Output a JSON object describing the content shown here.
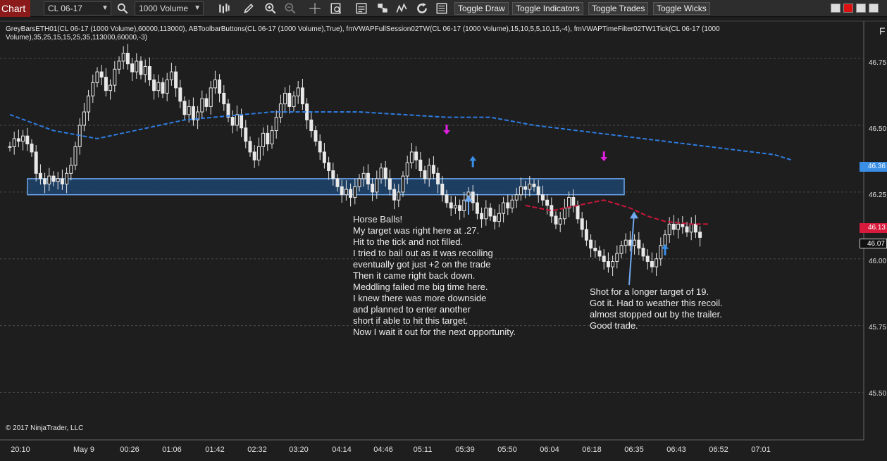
{
  "toolbar": {
    "chart_tab": "Chart",
    "instrument": "CL 06-17",
    "bar_type": "1000 Volume",
    "buttons": [
      "Toggle Draw",
      "Toggle Indicators",
      "Toggle Trades",
      "Toggle Wicks"
    ],
    "side_glyph": "F"
  },
  "indicator_text": "GreyBarsETH01(CL 06-17 (1000 Volume),60000,113000), ABToolbarButtons(CL 06-17 (1000 Volume),True), fmVWAPFullSession02TW(CL 06-17 (1000 Volume),15,10,5,5,10,15,-4), fmVWAPTimeFilter02TW1Tick(CL 06-17 (1000 Volume),35,25,15,15,25,35,113000,60000,-3)",
  "annotations": {
    "left_note": "Horse Balls!\nMy target was right here at .27.\nHit to the tick and not filled.\nI tried to bail out as it was recoiling\neventually got just +2 on the trade\nThen it came right back down.\nMeddling failed me big time here.\nI knew there was more downside\nand planned to enter another\nshort if able to hit this target.\nNow I wait it out for the next opportunity.",
    "right_note": "Shot for a longer target of 19.\nGot it. Had to weather this recoil.\nalmost stopped out by the trailer.\nGood trade."
  },
  "copyright": "© 2017 NinjaTrader, LLC",
  "price_tags": [
    {
      "label": "46.36",
      "color": "#3a8ee6"
    },
    {
      "label": "46.13",
      "color": "#d81b3c"
    },
    {
      "label": "46.07",
      "color": "#111111"
    }
  ],
  "colors": {
    "background": "#1e1e1e",
    "grid": "#4a4a4a",
    "candle": "#e8e8e8",
    "vwap_full": "#2e7be0",
    "vwap_filter": "#c8173a",
    "zone_fill": "#1f4a78",
    "zone_border": "#6fa8ee",
    "arrow_entry": "#e020e0",
    "arrow_exit": "#3a8ee6"
  },
  "chart_data": {
    "type": "candlestick",
    "title": "",
    "instrument": "CL 06-17 (1000 Volume)",
    "ylim": [
      45.33,
      46.89
    ],
    "y_ticks": [
      "46.75",
      "46.50",
      "46.25",
      "46.00",
      "45.75",
      "45.50"
    ],
    "x_ticks": [
      "20:10",
      "May 9",
      "00:26",
      "01:06",
      "01:42",
      "02:32",
      "03:20",
      "04:14",
      "04:46",
      "05:11",
      "05:39",
      "05:50",
      "06:04",
      "06:18",
      "06:35",
      "06:43",
      "06:52",
      "07:01"
    ],
    "close_series": [
      46.42,
      46.45,
      46.44,
      46.46,
      46.43,
      46.4,
      46.32,
      46.3,
      46.28,
      46.31,
      46.29,
      46.3,
      46.28,
      46.32,
      46.35,
      46.42,
      46.5,
      46.55,
      46.61,
      46.66,
      46.7,
      46.68,
      46.63,
      46.65,
      46.71,
      46.74,
      46.77,
      46.73,
      46.7,
      46.74,
      46.69,
      46.72,
      46.67,
      46.63,
      46.66,
      46.62,
      46.67,
      46.7,
      46.64,
      46.59,
      46.54,
      46.57,
      46.52,
      46.55,
      46.6,
      46.57,
      46.64,
      46.67,
      46.62,
      46.58,
      46.53,
      46.5,
      46.54,
      46.49,
      46.44,
      46.4,
      46.37,
      46.42,
      46.47,
      46.43,
      46.48,
      46.53,
      46.58,
      46.62,
      46.57,
      46.61,
      46.64,
      46.58,
      46.52,
      46.48,
      46.44,
      46.4,
      46.36,
      46.33,
      46.3,
      46.27,
      46.24,
      46.26,
      46.23,
      46.27,
      46.3,
      46.32,
      46.28,
      46.25,
      46.3,
      46.34,
      46.3,
      46.26,
      46.22,
      46.25,
      46.31,
      46.36,
      46.4,
      46.37,
      46.33,
      46.3,
      46.35,
      46.32,
      46.28,
      46.24,
      46.21,
      46.19,
      46.2,
      46.18,
      46.22,
      46.25,
      46.21,
      46.17,
      46.15,
      46.19,
      46.16,
      46.14,
      46.17,
      46.21,
      46.19,
      46.22,
      46.24,
      46.27,
      46.26,
      46.28,
      46.27,
      46.24,
      46.22,
      46.2,
      46.16,
      46.13,
      46.15,
      46.19,
      46.23,
      46.2,
      46.15,
      46.11,
      46.07,
      46.04,
      46.03,
      46.01,
      45.99,
      45.97,
      45.99,
      46.02,
      46.05,
      46.07,
      46.05,
      46.07,
      46.04,
      46.01,
      45.99,
      45.97,
      46.0,
      46.05,
      46.09,
      46.13,
      46.11,
      46.13,
      46.12,
      46.1,
      46.13,
      46.1,
      46.08
    ],
    "series": [
      {
        "name": "fmVWAPFullSession02TW",
        "points": [
          [
            0,
            46.54
          ],
          [
            10,
            46.48
          ],
          [
            20,
            46.45
          ],
          [
            40,
            46.52
          ],
          [
            60,
            46.55
          ],
          [
            80,
            46.55
          ],
          [
            100,
            46.53
          ],
          [
            110,
            46.53
          ],
          [
            120,
            46.5
          ],
          [
            140,
            46.46
          ],
          [
            160,
            46.42
          ],
          [
            175,
            46.39
          ],
          [
            179,
            46.37
          ]
        ]
      },
      {
        "name": "fmVWAPTimeFilter02TW1Tick",
        "points": [
          [
            118,
            46.2
          ],
          [
            124,
            46.18
          ],
          [
            130,
            46.2
          ],
          [
            136,
            46.22
          ],
          [
            142,
            46.19
          ],
          [
            146,
            46.16
          ],
          [
            150,
            46.14
          ],
          [
            156,
            46.13
          ],
          [
            160,
            46.13
          ]
        ]
      }
    ],
    "zone": {
      "price_low": 46.24,
      "price_high": 46.3,
      "bar_start": 0,
      "bar_end": 140
    },
    "markers": [
      {
        "type": "entry-short",
        "bar": 100,
        "price": 46.46
      },
      {
        "type": "exit",
        "bar": 106,
        "price": 46.38
      },
      {
        "type": "entry-short",
        "bar": 136,
        "price": 46.36
      },
      {
        "type": "exit",
        "bar": 150,
        "price": 46.05
      }
    ]
  }
}
